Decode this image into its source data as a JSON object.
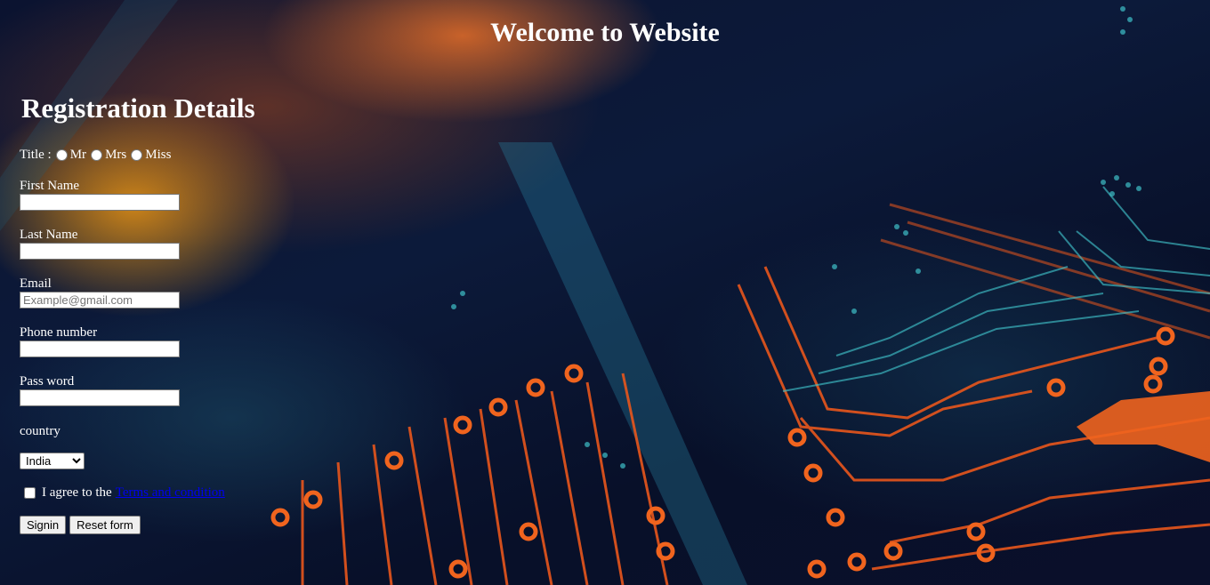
{
  "header": {
    "title": "Welcome to Website"
  },
  "form": {
    "title": "Registration Details",
    "title_label": "Title :",
    "title_options": [
      "Mr",
      "Mrs",
      "Miss"
    ],
    "first_name": {
      "label": "First Name",
      "value": "",
      "placeholder": ""
    },
    "last_name": {
      "label": "Last Name",
      "value": "",
      "placeholder": ""
    },
    "email": {
      "label": "Email",
      "value": "",
      "placeholder": "Example@gmail.com"
    },
    "phone": {
      "label": "Phone number",
      "value": "",
      "placeholder": ""
    },
    "password": {
      "label": "Pass word",
      "value": "",
      "placeholder": ""
    },
    "country": {
      "label": "country",
      "selected": "India"
    },
    "agree": {
      "text": "I agree to the",
      "link": "Terms and condition",
      "checked": false
    },
    "buttons": {
      "signin": "Signin",
      "reset": "Reset form"
    }
  },
  "colors": {
    "link": "#0000ee",
    "text": "#ffffff",
    "accent_orange": "#f0641e",
    "accent_cyan": "#3fc0c8"
  }
}
